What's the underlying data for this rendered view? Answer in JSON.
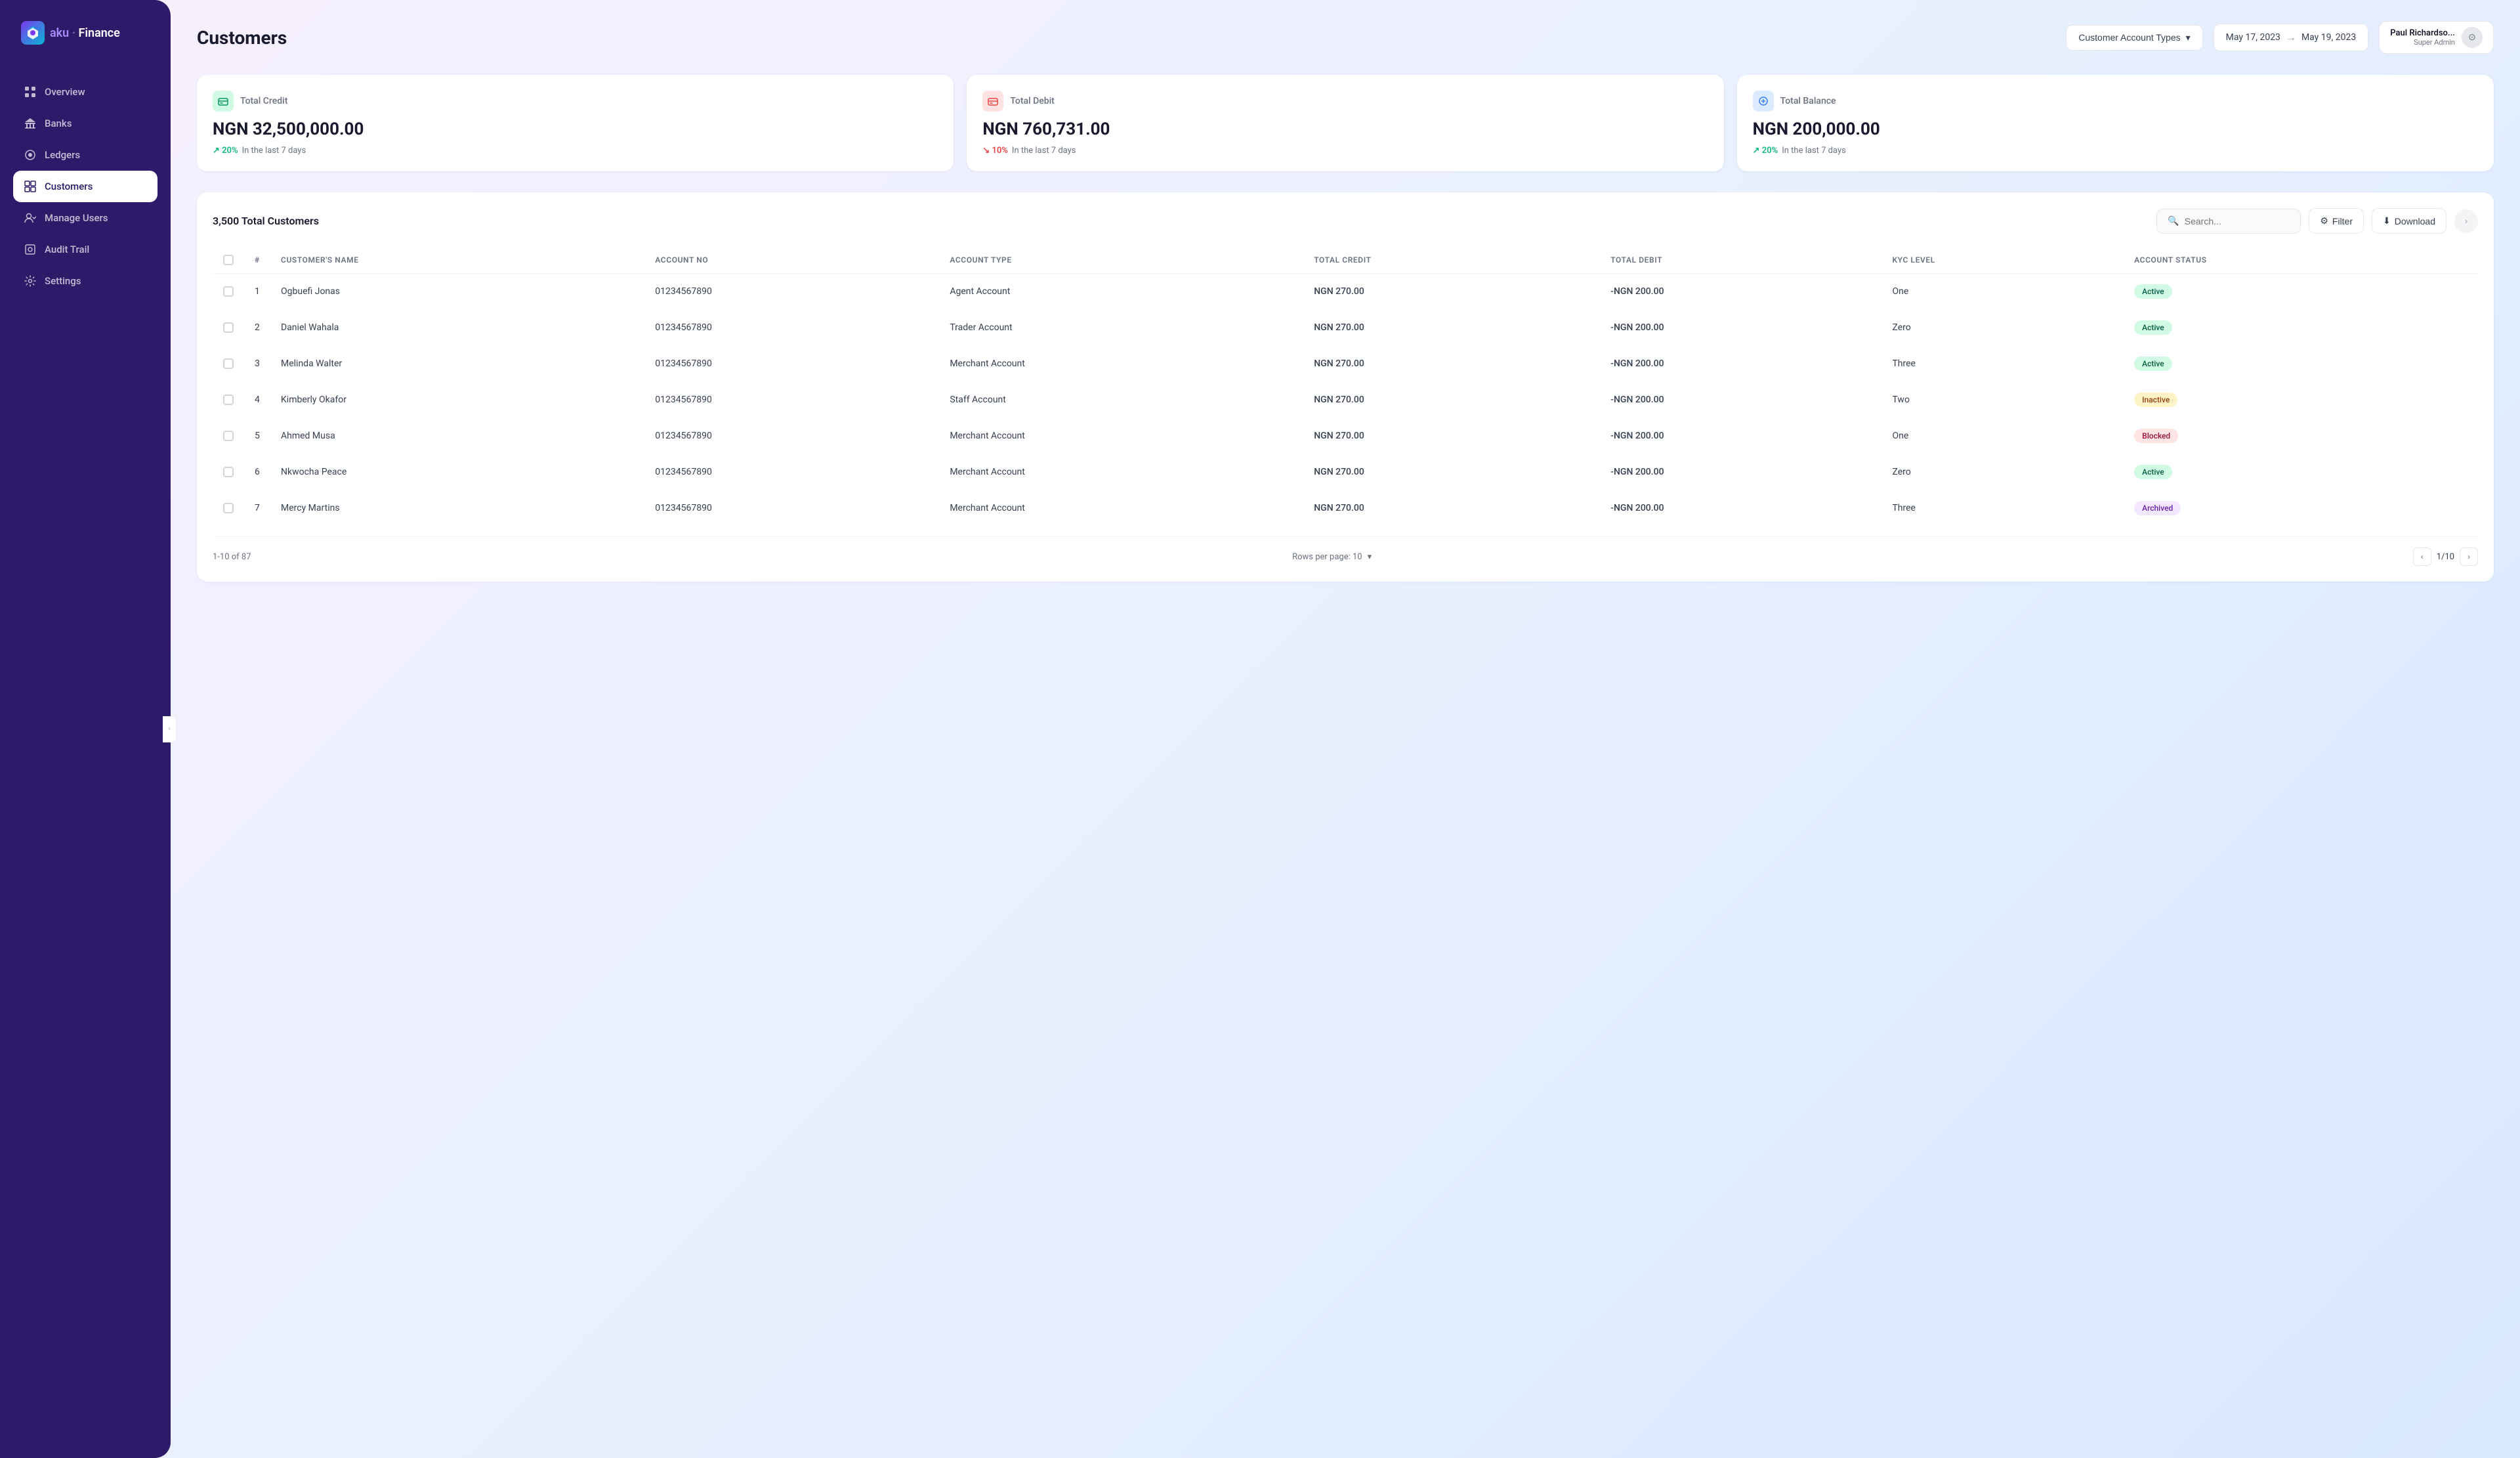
{
  "sidebar": {
    "logo_text": "Finance",
    "logo_abbr": "aku",
    "nav_items": [
      {
        "id": "overview",
        "label": "Overview",
        "icon": "⊞",
        "active": false
      },
      {
        "id": "banks",
        "label": "Banks",
        "icon": "🏦",
        "active": false
      },
      {
        "id": "ledgers",
        "label": "Ledgers",
        "icon": "◎",
        "active": false
      },
      {
        "id": "customers",
        "label": "Customers",
        "icon": "⊠",
        "active": true
      },
      {
        "id": "manage-users",
        "label": "Manage Users",
        "icon": "👤",
        "active": false
      },
      {
        "id": "audit-trail",
        "label": "Audit Trail",
        "icon": "◈",
        "active": false
      },
      {
        "id": "settings",
        "label": "Settings",
        "icon": "⚙",
        "active": false
      }
    ]
  },
  "page": {
    "title": "Customers",
    "account_types_label": "Customer Account Types",
    "date_from": "May 17, 2023",
    "date_to": "May 19, 2023",
    "user_name": "Paul Richardso...",
    "user_role": "Super Admin"
  },
  "summary_cards": [
    {
      "id": "total-credit",
      "label": "Total Credit",
      "amount": "NGN 32,500,000.00",
      "trend": "+",
      "trend_pct": "20%",
      "trend_label": "In the last 7 days",
      "trend_dir": "up",
      "icon": "💳",
      "icon_class": "green"
    },
    {
      "id": "total-debit",
      "label": "Total Debit",
      "amount": "NGN 760,731.00",
      "trend": "↘",
      "trend_pct": "10%",
      "trend_label": "In the last 7 days",
      "trend_dir": "down",
      "icon": "💳",
      "icon_class": "red"
    },
    {
      "id": "total-balance",
      "label": "Total Balance",
      "amount": "NGN 200,000.00",
      "trend": "+",
      "trend_pct": "20%",
      "trend_label": "In the last 7 days",
      "trend_dir": "up",
      "icon": "💰",
      "icon_class": "blue"
    }
  ],
  "table": {
    "total_label": "3,500 Total Customers",
    "search_placeholder": "Search...",
    "filter_label": "Filter",
    "download_label": "Download",
    "columns": [
      "#",
      "CUSTOMER'S NAME",
      "ACCOUNT NO",
      "ACCOUNT TYPE",
      "TOTAL CREDIT",
      "TOTAL DEBIT",
      "KYC LEVEL",
      "ACCOUNT STATUS"
    ],
    "rows": [
      {
        "num": "1",
        "name": "Ogbuefi Jonas",
        "account_no": "01234567890",
        "account_type": "Agent Account",
        "total_credit": "NGN 270.00",
        "total_debit": "-NGN 200.00",
        "kyc_level": "One",
        "status": "Active",
        "status_class": "status-active"
      },
      {
        "num": "2",
        "name": "Daniel Wahala",
        "account_no": "01234567890",
        "account_type": "Trader Account",
        "total_credit": "NGN 270.00",
        "total_debit": "-NGN 200.00",
        "kyc_level": "Zero",
        "status": "Active",
        "status_class": "status-active"
      },
      {
        "num": "3",
        "name": "Melinda Walter",
        "account_no": "01234567890",
        "account_type": "Merchant Account",
        "total_credit": "NGN 270.00",
        "total_debit": "-NGN 200.00",
        "kyc_level": "Three",
        "status": "Active",
        "status_class": "status-active"
      },
      {
        "num": "4",
        "name": "Kimberly Okafor",
        "account_no": "01234567890",
        "account_type": "Staff Account",
        "total_credit": "NGN 270.00",
        "total_debit": "-NGN 200.00",
        "kyc_level": "Two",
        "status": "Inactive",
        "status_class": "status-inactive"
      },
      {
        "num": "5",
        "name": "Ahmed Musa",
        "account_no": "01234567890",
        "account_type": "Merchant Account",
        "total_credit": "NGN 270.00",
        "total_debit": "-NGN 200.00",
        "kyc_level": "One",
        "status": "Blocked",
        "status_class": "status-blocked"
      },
      {
        "num": "6",
        "name": "Nkwocha Peace",
        "account_no": "01234567890",
        "account_type": "Merchant Account",
        "total_credit": "NGN 270.00",
        "total_debit": "-NGN 200.00",
        "kyc_level": "Zero",
        "status": "Active",
        "status_class": "status-active"
      },
      {
        "num": "7",
        "name": "Mercy Martins",
        "account_no": "01234567890",
        "account_type": "Merchant Account",
        "total_credit": "NGN 270.00",
        "total_debit": "-NGN 200.00",
        "kyc_level": "Three",
        "status": "Archived",
        "status_class": "status-archived"
      }
    ],
    "pagination": {
      "page_info": "1-10 of 87",
      "rows_per_page_label": "Rows per page: 10",
      "page_display": "1/10"
    }
  }
}
